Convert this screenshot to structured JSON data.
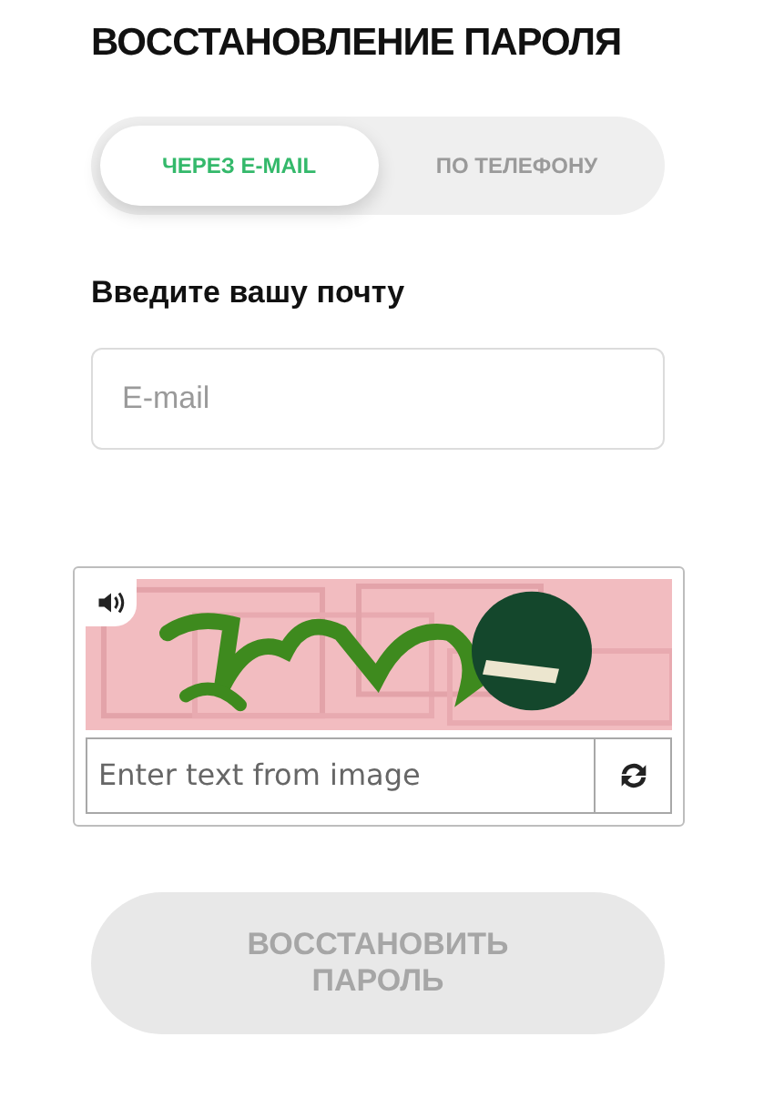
{
  "title": "ВОССТАНОВЛЕНИЕ ПАРОЛЯ",
  "tabs": [
    {
      "label": "ЧЕРЕЗ E-MAIL",
      "selected": true
    },
    {
      "label": "ПО ТЕЛЕФОНУ",
      "selected": false
    }
  ],
  "email": {
    "label": "Введите вашу почту",
    "placeholder": "E-mail"
  },
  "captcha": {
    "placeholder": "Enter text from image"
  },
  "submit": {
    "label": "ВОССТАНОВИТЬ ПАРОЛЬ",
    "disabled": true
  }
}
